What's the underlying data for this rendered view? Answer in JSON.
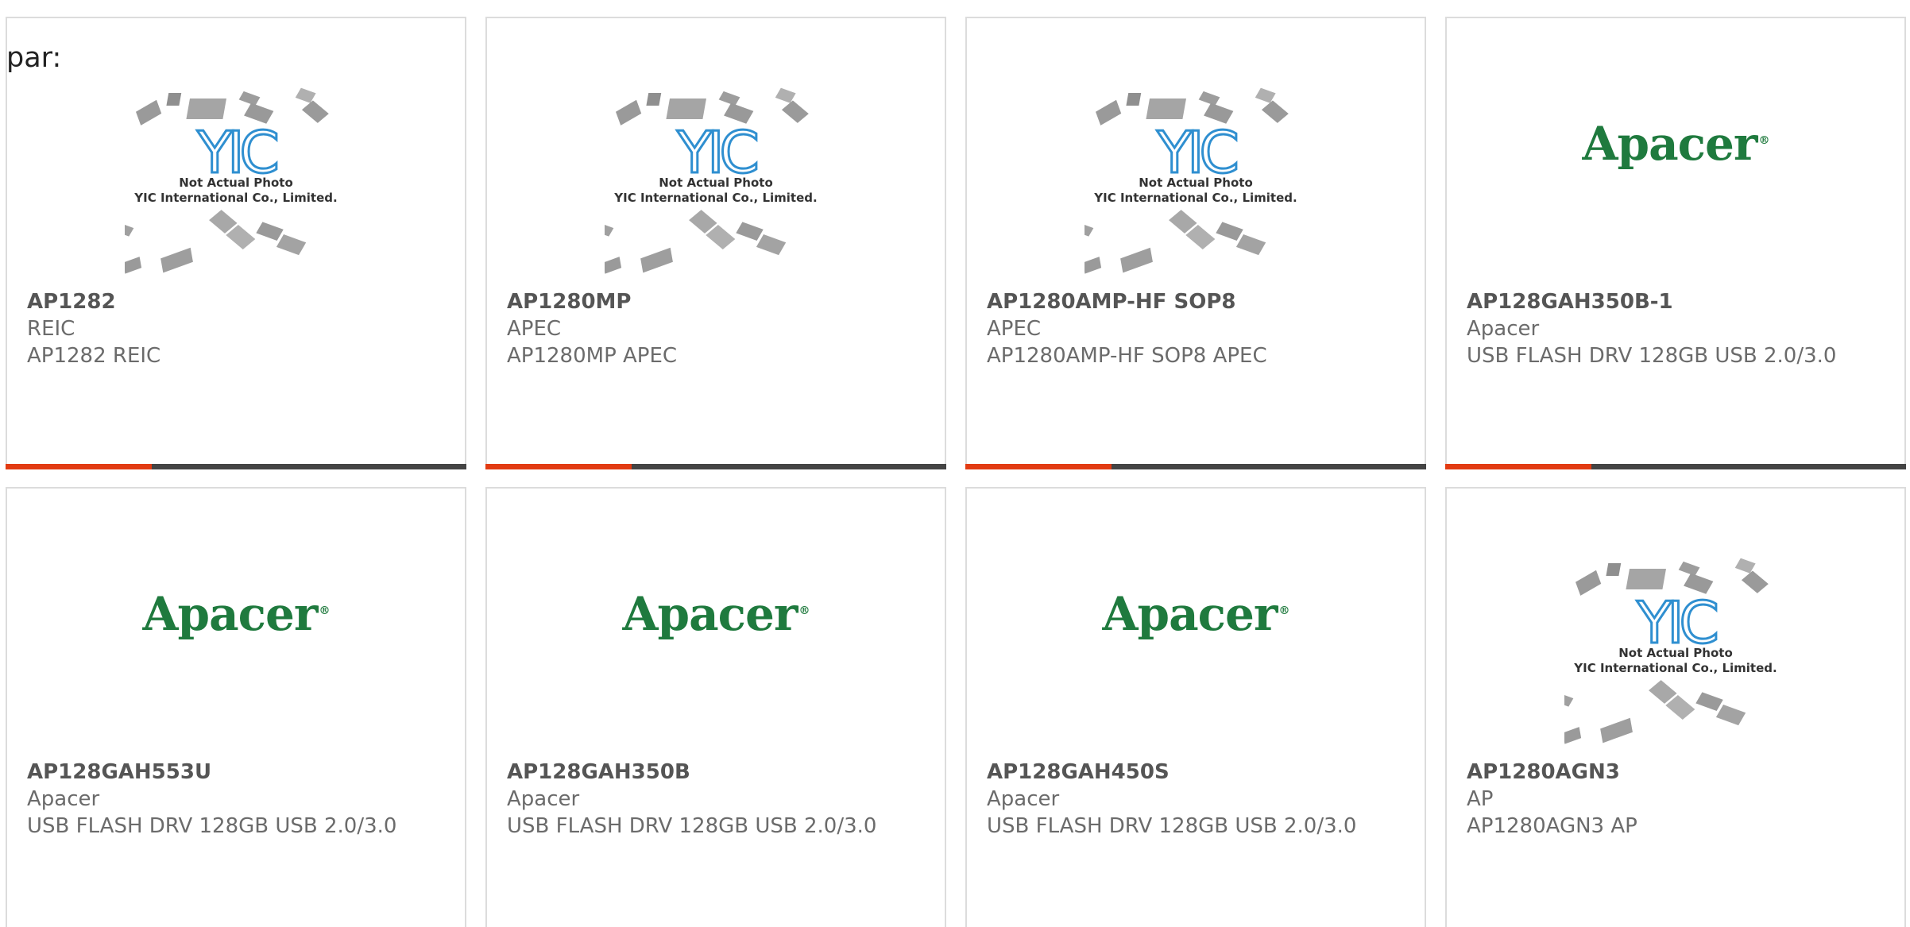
{
  "stray_label": "par:",
  "placeholder": {
    "logo_text": "YIC",
    "line1": "Not Actual Photo",
    "line2": "YIC International Co., Limited."
  },
  "brand_logo": {
    "text": "Apacer",
    "mark": "®",
    "color": "#1f7a3e"
  },
  "accent_color": "#e23b12",
  "products": [
    {
      "part": "AP1282",
      "manufacturer": "REIC",
      "description": "AP1282 REIC",
      "image": "placeholder"
    },
    {
      "part": "AP1280MP",
      "manufacturer": "APEC",
      "description": "AP1280MP APEC",
      "image": "placeholder"
    },
    {
      "part": "AP1280AMP-HF SOP8",
      "manufacturer": "APEC",
      "description": "AP1280AMP-HF SOP8 APEC",
      "image": "placeholder"
    },
    {
      "part": "AP128GAH350B-1",
      "manufacturer": "Apacer",
      "description": "USB FLASH DRV 128GB USB 2.0/3.0",
      "image": "apacer"
    },
    {
      "part": "AP128GAH553U",
      "manufacturer": "Apacer",
      "description": "USB FLASH DRV 128GB USB 2.0/3.0",
      "image": "apacer"
    },
    {
      "part": "AP128GAH350B",
      "manufacturer": "Apacer",
      "description": "USB FLASH DRV 128GB USB 2.0/3.0",
      "image": "apacer"
    },
    {
      "part": "AP128GAH450S",
      "manufacturer": "Apacer",
      "description": "USB FLASH DRV 128GB USB 2.0/3.0",
      "image": "apacer"
    },
    {
      "part": "AP1280AGN3",
      "manufacturer": "AP",
      "description": "AP1280AGN3 AP",
      "image": "placeholder"
    }
  ]
}
